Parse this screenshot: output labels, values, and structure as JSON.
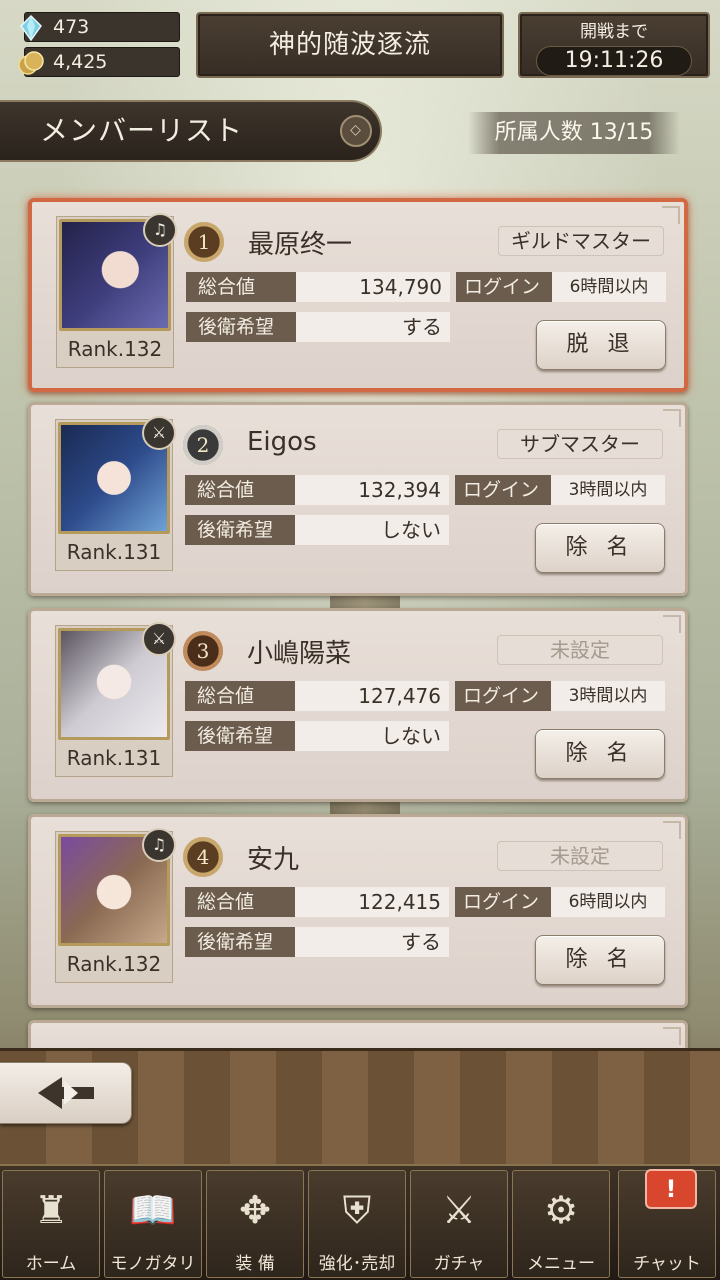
{
  "resources": {
    "crystal": "473",
    "coin": "4,425"
  },
  "guild": {
    "name": "神的随波逐流"
  },
  "battle": {
    "label": "開戦まで",
    "countdown": "19:11:26"
  },
  "list": {
    "title": "メンバーリスト",
    "member_count": "所属人数 13/15",
    "labels": {
      "total": "総合値",
      "rear": "後衛希望",
      "login": "ログイン"
    }
  },
  "members": [
    {
      "rank_no": "1",
      "name": "最原终一",
      "role": "ギルドマスター",
      "rank": "Rank.132",
      "total": "134,790",
      "rear_pref": "する",
      "login": "6時間以内",
      "action": "脱 退",
      "weapon_icon": "harp-icon"
    },
    {
      "rank_no": "2",
      "name": "Eigos",
      "role": "サブマスター",
      "rank": "Rank.131",
      "total": "132,394",
      "rear_pref": "しない",
      "login": "3時間以内",
      "action": "除 名",
      "weapon_icon": "sword-icon"
    },
    {
      "rank_no": "3",
      "name": "小嶋陽菜",
      "role": "未設定",
      "rank": "Rank.131",
      "total": "127,476",
      "rear_pref": "しない",
      "login": "3時間以内",
      "action": "除 名",
      "weapon_icon": "sword-icon"
    },
    {
      "rank_no": "4",
      "name": "安九",
      "role": "未設定",
      "rank": "Rank.132",
      "total": "122,415",
      "rear_pref": "する",
      "login": "6時間以内",
      "action": "除 名",
      "weapon_icon": "harp-icon"
    }
  ],
  "nav": {
    "home": "ホーム",
    "story": "モノガタリ",
    "equip": "装 備",
    "enhance": "強化･売却",
    "gacha": "ガチャ",
    "menu": "メニュー",
    "chat": "チャット",
    "chat_alert": "!"
  },
  "colors": {
    "master_highlight": "#d16a44",
    "stat_label_bg": "#6b5c4d",
    "chat_alert": "#d8462e"
  }
}
